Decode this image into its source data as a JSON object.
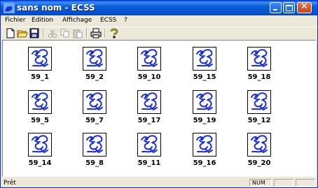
{
  "window": {
    "title": "sans nom - ECSS"
  },
  "menu": [
    "Fichier",
    "Edition",
    "Affichage",
    "ECSS",
    "?"
  ],
  "toolbar": {
    "icons": [
      "new-file-icon",
      "open-folder-icon",
      "save-disk-icon",
      "cut-icon",
      "copy-icon",
      "paste-icon",
      "print-icon",
      "help-icon"
    ]
  },
  "thumbnails": [
    "59_1",
    "59_2",
    "59_10",
    "59_15",
    "59_18",
    "59_5",
    "59_7",
    "59_17",
    "59_19",
    "59_12",
    "59_14",
    "59_8",
    "59_11",
    "59_16",
    "59_20"
  ],
  "status": {
    "text": "Prêt",
    "num": "NUM"
  },
  "colors": {
    "title_bar": "#0a5fd8",
    "glyph_blue": "#1a2fe0",
    "chrome": "#ece9d8"
  }
}
